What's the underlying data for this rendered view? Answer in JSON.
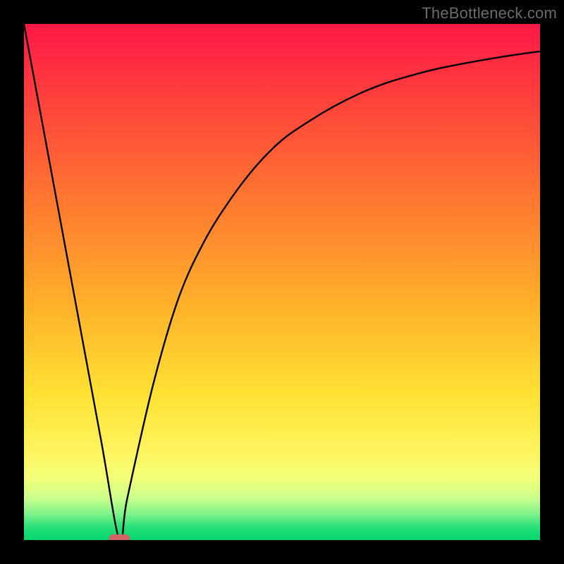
{
  "attribution": "TheBottleneck.com",
  "chart_data": {
    "type": "line",
    "title": "",
    "xlabel": "",
    "ylabel": "",
    "xlim": [
      0,
      100
    ],
    "ylim": [
      0,
      100
    ],
    "grid": false,
    "background_gradient": {
      "top": "#ff1846",
      "middle": "#ffe233",
      "bottom": "#00d66e"
    },
    "series": [
      {
        "name": "bottleneck-curve",
        "x": [
          0,
          5,
          10,
          15,
          18.5,
          20,
          25,
          30,
          35,
          40,
          45,
          50,
          55,
          60,
          65,
          70,
          75,
          80,
          85,
          90,
          95,
          100
        ],
        "values": [
          100,
          73,
          46,
          19,
          0,
          8,
          30,
          47,
          58,
          66,
          72.5,
          77.5,
          81,
          84,
          86.5,
          88.5,
          90,
          91.3,
          92.3,
          93.2,
          94,
          94.7
        ]
      }
    ],
    "marker": {
      "name": "min-point",
      "x": 18.5,
      "y": 0,
      "color": "#d06565",
      "shape": "rounded-rect"
    }
  }
}
